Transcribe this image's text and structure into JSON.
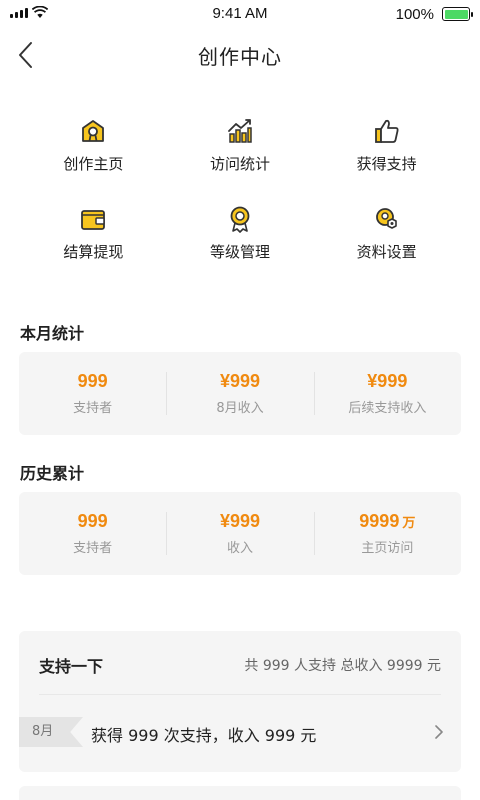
{
  "status_bar": {
    "time": "9:41 AM",
    "battery": "100%"
  },
  "nav": {
    "title": "创作中心"
  },
  "menu": [
    {
      "icon": "home-badge-icon",
      "label": "创作主页"
    },
    {
      "icon": "bar-chart-icon",
      "label": "访问统计"
    },
    {
      "icon": "thumbs-up-icon",
      "label": "获得支持"
    },
    {
      "icon": "wallet-icon",
      "label": "结算提现"
    },
    {
      "icon": "medal-icon",
      "label": "等级管理"
    },
    {
      "icon": "profile-settings-icon",
      "label": "资料设置"
    }
  ],
  "monthly": {
    "title": "本月统计",
    "stats": [
      {
        "value": "999",
        "unit": "",
        "label": "支持者"
      },
      {
        "value": "¥999",
        "unit": "",
        "label": "8月收入"
      },
      {
        "value": "¥999",
        "unit": "",
        "label": "后续支持收入"
      }
    ]
  },
  "history": {
    "title": "历史累计",
    "stats": [
      {
        "value": "999",
        "unit": "",
        "label": "支持者"
      },
      {
        "value": "¥999",
        "unit": "",
        "label": "收入"
      },
      {
        "value": "9999",
        "unit": "万",
        "label": "主页访问"
      }
    ]
  },
  "support": {
    "title": "支持一下",
    "summary": "共 999 人支持   总收入 9999 元",
    "item": {
      "month": "8月",
      "text": "获得 999 次支持，收入 999 元"
    }
  },
  "colors": {
    "accent": "#f08a10",
    "icon_yellow": "#f7c51e",
    "card_bg": "#f5f5f5"
  }
}
